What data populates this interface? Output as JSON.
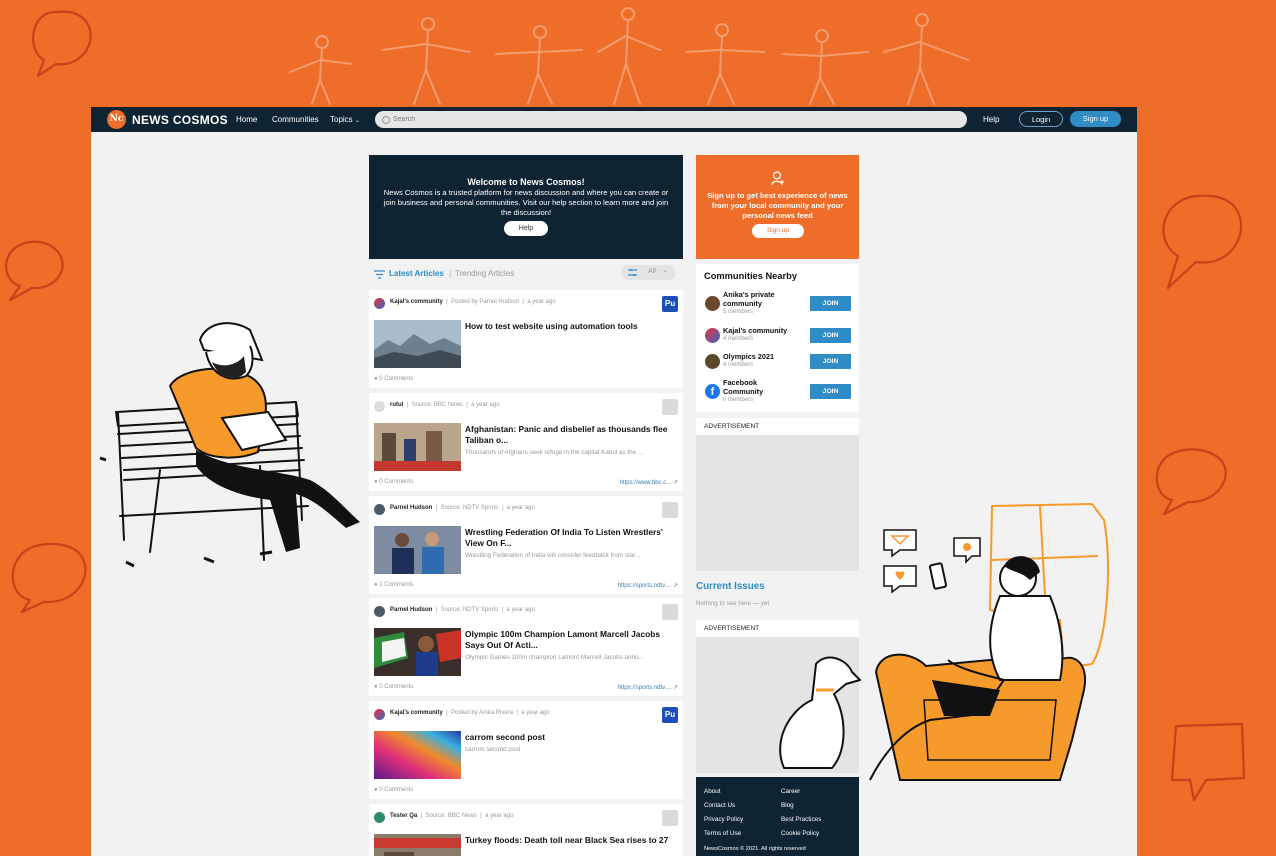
{
  "header": {
    "logo_text": "Nc",
    "brand": "NEWS COSMOS",
    "nav": {
      "home": "Home",
      "communities": "Communities",
      "topics": "Topics"
    },
    "search_placeholder": "Search",
    "help": "Help",
    "login": "Login",
    "signup": "Sign up"
  },
  "welcome": {
    "title": "Welcome to News Cosmos!",
    "text": "News Cosmos is a trusted platform for news discussion and where you can create or join business and personal communities. Visit our help section to learn more and join the discussion!",
    "button": "Help"
  },
  "feed": {
    "tab_latest": "Latest Articles",
    "tab_trending": "Trending Articles",
    "filter_label": "All",
    "articles": [
      {
        "community": "Kajal's community",
        "meta": "Posted by Parnel Hudson",
        "time": "a year ago",
        "badge": "Pu",
        "title": "How to test website using automation tools",
        "summary": "",
        "comments": "0 Comments",
        "url": ""
      },
      {
        "community": "rutul",
        "meta": "Source: BBC News",
        "time": "a year ago",
        "badge": "",
        "title": "Afghanistan: Panic and disbelief as thousands flee Taliban o...",
        "summary": "Thousands of Afghans seek refuge in the capital Kabul as the ...",
        "comments": "0 Comments",
        "url": "https://www.bbc.c..."
      },
      {
        "community": "Parnel Hudson",
        "meta": "Source: NDTV Sports",
        "time": "a year ago",
        "badge": "",
        "title": "Wrestling Federation Of India To Listen Wrestlers' View On F...",
        "summary": "Wrestling Federation of India will consider feedback from star...",
        "comments": "1 Comments",
        "url": "https://sports.ndtv...."
      },
      {
        "community": "Parnel Hudson",
        "meta": "Source: NDTV Sports",
        "time": "a year ago",
        "badge": "",
        "title": "Olympic 100m Champion Lamont Marcell Jacobs Says Out Of Acti...",
        "summary": "Olympic Games 100m champion Lamont Marcell Jacobs anno...",
        "comments": "0 Comments",
        "url": "https://sports.ndtv...."
      },
      {
        "community": "Kajal's community",
        "meta": "Posted by Anika Rivera",
        "time": "a year ago",
        "badge": "Pu",
        "title": "carrom second post",
        "summary": "carrom second post",
        "comments": "0 Comments",
        "url": ""
      },
      {
        "community": "Tester Qa",
        "meta": "Source: BBC News",
        "time": "a year ago",
        "badge": "",
        "title": "Turkey floods: Death toll near Black Sea rises to 27",
        "summary": "",
        "comments": "",
        "url": ""
      }
    ]
  },
  "promo": {
    "text": "Sign up to get best experience of news from your local community and your personal news feed",
    "button": "Sign up"
  },
  "communities": {
    "title": "Communities Nearby",
    "join_label": "JOIN",
    "items": [
      {
        "name": "Anika's private community",
        "members": "5 members"
      },
      {
        "name": "Kajal's community",
        "members": "4 members"
      },
      {
        "name": "Olympics 2021",
        "members": "4 members"
      },
      {
        "name": "Facebook Community",
        "members": "0 members"
      }
    ]
  },
  "ads": {
    "label": "ADVERTISEMENT"
  },
  "current_issues": {
    "title": "Current Issues",
    "empty": "Nothing to see here — yet"
  },
  "footer": {
    "about": "About",
    "career": "Career",
    "contact": "Contact Us",
    "blog": "Blog",
    "privacy": "Privacy Policy",
    "best_practices": "Best Practices",
    "terms": "Terms of Use",
    "cookie": "Cookie Policy",
    "copyright": "NewsCosmos © 2021. All rights reserved"
  },
  "colors": {
    "background": "#EE6D28",
    "navy": "#0E2433",
    "accent_blue": "#2F8CC4",
    "badge_blue": "#1E4FB8"
  }
}
